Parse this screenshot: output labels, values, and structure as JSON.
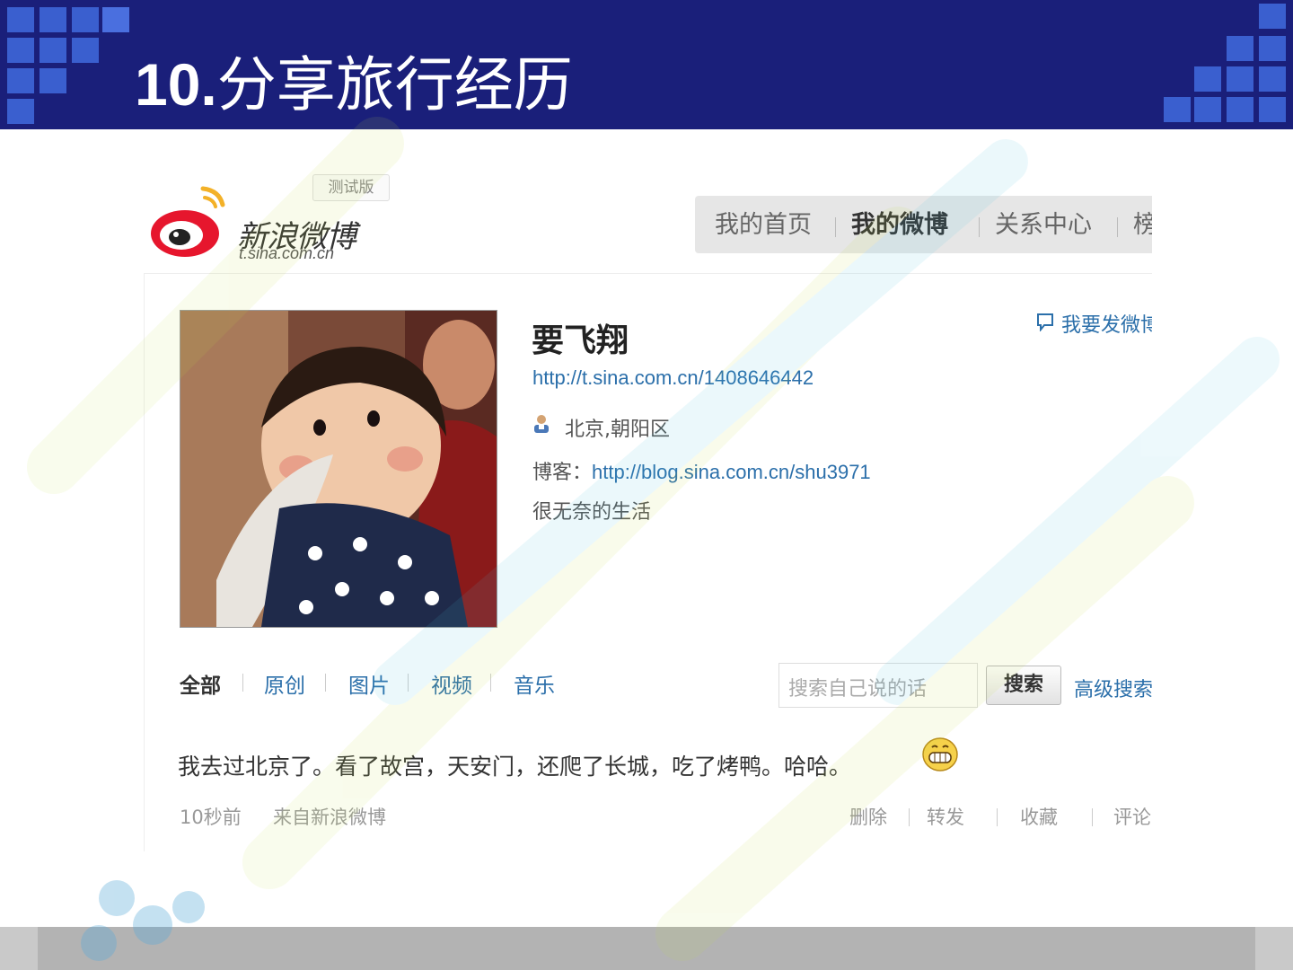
{
  "slide": {
    "title_number": "10.",
    "title_text": "分享旅行经历"
  },
  "weibo": {
    "beta_label": "测试版",
    "logo_name": "新浪微博",
    "logo_url": "t.sina.com.cn",
    "nav": [
      "我的首页",
      "我的微博",
      "关系中心",
      "榜"
    ],
    "nav_active": "我的微博",
    "profile": {
      "nickname": "要飞翔",
      "url": "http://t.sina.com.cn/1408646442",
      "location": "北京,朝阳区",
      "blog_label": "博客：",
      "blog_url": "http://blog.sina.com.cn/shu3971",
      "bio": "很无奈的生活"
    },
    "post_link": "我要发微博",
    "filters": [
      "全部",
      "原创",
      "图片",
      "视频",
      "音乐"
    ],
    "filter_active": "全部",
    "search": {
      "placeholder": "搜索自己说的话",
      "button": "搜索",
      "advanced": "高级搜索"
    },
    "post": {
      "text": "我去过北京了。看了故宫，天安门，还爬了长城，吃了烤鸭。哈哈。",
      "time": "10秒前",
      "source": "来自新浪微博",
      "actions": [
        "删除",
        "转发",
        "收藏",
        "评论"
      ]
    },
    "icons": {
      "location": "person-location-icon",
      "post": "speech-bubble-icon",
      "emoji": "grin-emoji-icon"
    }
  },
  "colors": {
    "header_bg": "#1a1f7a",
    "link": "#2b6faa",
    "footer": "#b3b3b3"
  }
}
